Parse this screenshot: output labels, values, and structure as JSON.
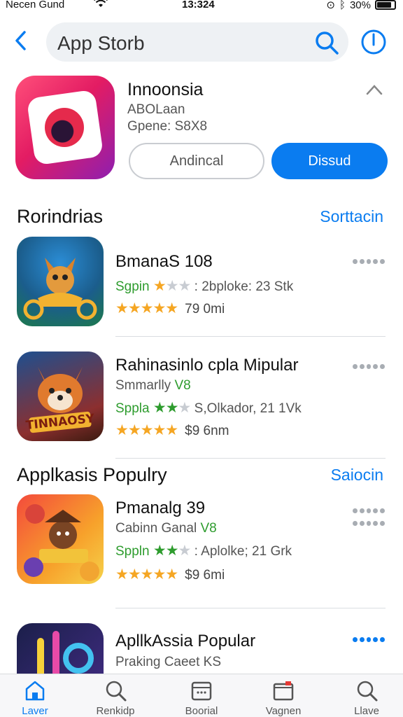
{
  "status_bar": {
    "carrier": "Necen Gund",
    "time": "13:324",
    "battery": "30%"
  },
  "search": {
    "value": "App Storb"
  },
  "featured": {
    "title": "Innoonsia",
    "subtitle": "ABOLaan",
    "meta": "Gpene: S8X8",
    "secondary_button": "Andincal",
    "primary_button": "Dissud"
  },
  "section1": {
    "title": "Rorindrias",
    "link": "Sorttacin"
  },
  "section2": {
    "title": "Applkasis Populry",
    "link": "Saiocin"
  },
  "apps": [
    {
      "title": "BmanaS 108",
      "line1_green": "Sgpin",
      "line1_rest": ": 2bploke: 23 Stk",
      "rating": 4.5,
      "price": "79 0mi"
    },
    {
      "title": "Rahinasinlo cpla Mipular",
      "line0": "Smmarlly",
      "line0_green": "V8",
      "line1_green": "Sppla",
      "line1_rest": "S,Olkador, 21 1Vk",
      "rating": 4.5,
      "price": "$9 6nm"
    },
    {
      "title": "Pmanalg 39",
      "line0": "Cabinn Ganal",
      "line0_green": "V8",
      "line1_green": "Sppln",
      "line1_rest": ": Aplolke; 21 Grk",
      "rating": 4.5,
      "price": "$9 6mi"
    },
    {
      "title": "ApllkAssia Popular",
      "line0": "Praking Caeet KS"
    }
  ],
  "tabs": [
    {
      "label": "Laver",
      "icon": "home-icon"
    },
    {
      "label": "Renkidp",
      "icon": "search-icon"
    },
    {
      "label": "Boorial",
      "icon": "calendar-icon"
    },
    {
      "label": "Vagnen",
      "icon": "inbox-icon"
    },
    {
      "label": "Llave",
      "icon": "search-icon"
    }
  ],
  "colors": {
    "accent": "#0a7cf0",
    "star": "#f5a623",
    "green": "#2e9c2e"
  }
}
